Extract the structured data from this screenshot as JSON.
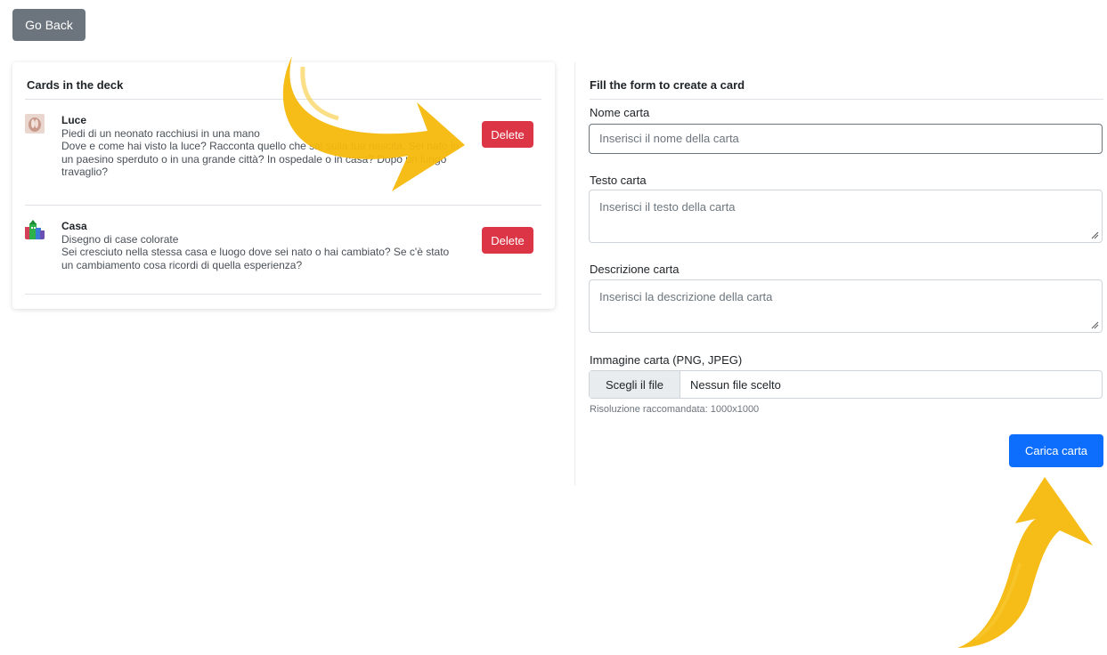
{
  "header": {
    "back_label": "Go Back"
  },
  "deck": {
    "title": "Cards in the deck",
    "delete_label": "Delete",
    "items": [
      {
        "name": "Luce",
        "text": "Piedi di un neonato racchiusi in una mano",
        "description": "Dove e come hai visto la luce? Racconta quello che sai sulla tua nascita. Sei nato in un paesino sperduto o in una grande città? In ospedale o in casa? Dopo un lungo travaglio?"
      },
      {
        "name": "Casa",
        "text": "Disegno di case colorate",
        "description": "Sei cresciuto nella stessa casa e luogo dove sei nato o hai cambiato? Se c'è stato un cambiamento cosa ricordi di quella esperienza?"
      }
    ]
  },
  "form": {
    "title": "Fill the form to create a card",
    "name_label": "Nome carta",
    "name_placeholder": "Inserisci il nome della carta",
    "text_label": "Testo carta",
    "text_placeholder": "Inserisci il testo della carta",
    "description_label": "Descrizione carta",
    "description_placeholder": "Inserisci la descrizione della carta",
    "image_label": "Immagine carta (PNG, JPEG)",
    "file_button": "Scegli il file",
    "file_status": "Nessun file scelto",
    "help_text": "Risoluzione raccomandata: 1000x1000",
    "submit_label": "Carica carta"
  },
  "colors": {
    "primary": "#0d6efd",
    "danger": "#dc3545",
    "secondary": "#6c757d",
    "annotation_arrow": "#f5b80c"
  },
  "icons": [
    "luce-thumbnail",
    "casa-thumbnail",
    "resize-handle-icon",
    "annotation-arrow"
  ]
}
